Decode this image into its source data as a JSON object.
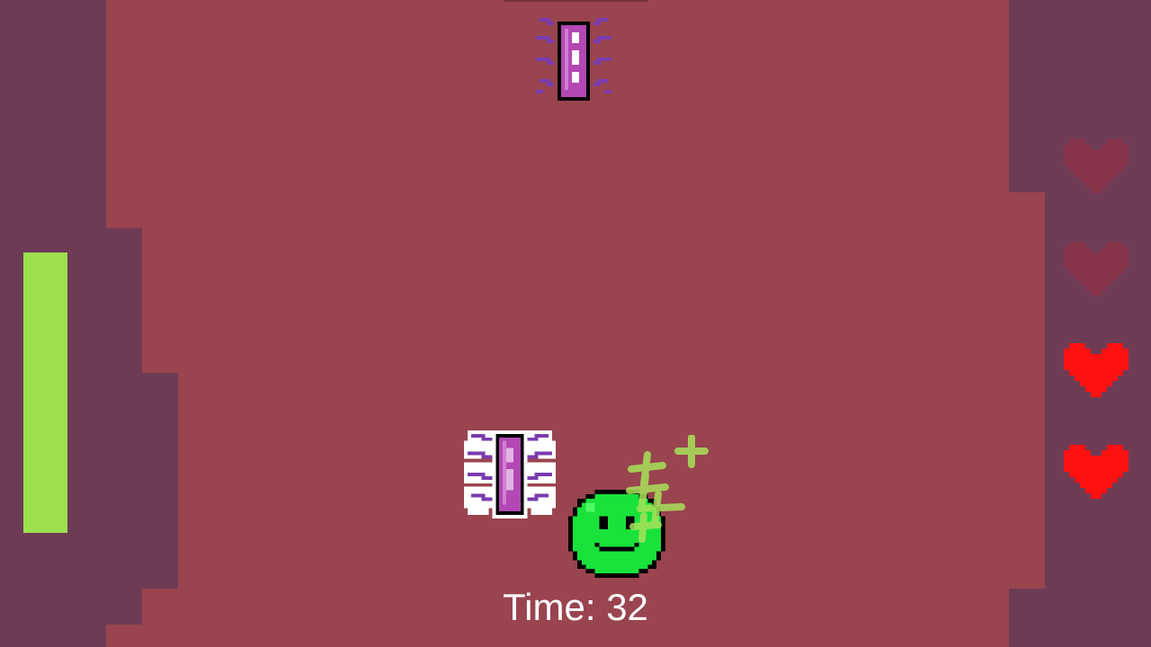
{
  "hud": {
    "timer_text": "Time: 32",
    "stamina_level": 1.0,
    "hearts": [
      {
        "state": "empty"
      },
      {
        "state": "empty"
      },
      {
        "state": "full"
      },
      {
        "state": "full"
      }
    ]
  },
  "entities": {
    "player": {
      "kind": "green-slime",
      "icon": "smiley-slime-icon"
    },
    "enemies": [
      {
        "kind": "purple-bug",
        "icon": "purple-bug-icon"
      },
      {
        "kind": "purple-bug-glowing",
        "icon": "purple-bug-glowing-icon"
      }
    ],
    "effect": {
      "kind": "sparkle-crosses",
      "icon": "sparkle-icon"
    }
  },
  "colors": {
    "wall": "#6e3b55",
    "floor": "#99444f",
    "stamina": "#9de050",
    "heart_full": "#ff1111",
    "heart_empty": "#87334a",
    "slime": "#19e23b",
    "slime_outline": "#000000",
    "bug_body": "#b347b4",
    "bug_legs": "#7a3bb0",
    "sparkle": "#a8e25a",
    "timer_text": "#ffffff"
  }
}
